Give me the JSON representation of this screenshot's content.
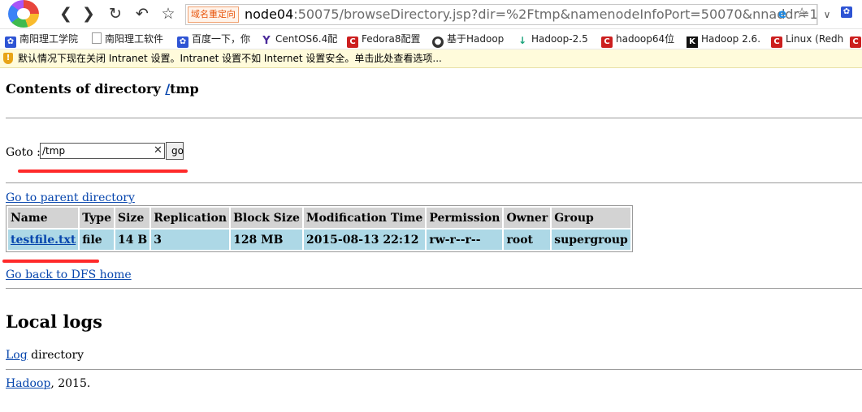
{
  "browser": {
    "redirect_badge": "域名重定向",
    "url_host": "node04",
    "url_rest": ":50075/browseDirectory.jsp?dir=%2Ftmp&namenodeInfoPort=50070&nnaddr=1",
    "nav_icons": [
      "back-icon",
      "forward-icon",
      "reload-icon",
      "undo-icon",
      "star-icon"
    ]
  },
  "bookmarks": [
    {
      "label": "南阳理工学院",
      "icon": "paw-icon"
    },
    {
      "label": "南阳理工软件",
      "icon": "page-icon"
    },
    {
      "label": "百度一下，你",
      "icon": "paw-icon"
    },
    {
      "label": "CentOS6.4配",
      "icon": "y-icon"
    },
    {
      "label": "Fedora8配置",
      "icon": "c-icon"
    },
    {
      "label": "基于Hadoop",
      "icon": "globe-icon"
    },
    {
      "label": "Hadoop-2.5",
      "icon": "h-icon"
    },
    {
      "label": "hadoop64位",
      "icon": "c-icon"
    },
    {
      "label": "Hadoop 2.6.",
      "icon": "k-icon"
    },
    {
      "label": "Linux (Redh",
      "icon": "c-icon"
    }
  ],
  "infobar": {
    "text": "默认情况下现在关闭 Intranet 设置。Intranet 设置不如 Internet 设置安全。单击此处查看选项..."
  },
  "page": {
    "title_prefix": "Contents of directory ",
    "title_root_link": "/",
    "title_dir": "tmp",
    "goto_label": "Goto : ",
    "goto_value": "/tmp",
    "go_button": "go",
    "parent_link": "Go to parent directory",
    "table": {
      "headers": [
        "Name",
        "Type",
        "Size",
        "Replication",
        "Block Size",
        "Modification Time",
        "Permission",
        "Owner",
        "Group"
      ],
      "rows": [
        [
          "testfile.txt",
          "file",
          "14 B",
          "3",
          "128 MB",
          "2015-08-13 22:12",
          "rw-r--r--",
          "root",
          "supergroup"
        ]
      ]
    },
    "back_link": "Go back to DFS home",
    "logs_heading": "Local logs",
    "log_link": "Log",
    "log_suffix": " directory",
    "footer_link": "Hadoop",
    "footer_suffix": ", 2015."
  },
  "colors": {
    "header_cell": "#d3d3d3",
    "data_cell": "#add8e6",
    "link": "#0645ad",
    "annotation": "#ff2a2a"
  }
}
